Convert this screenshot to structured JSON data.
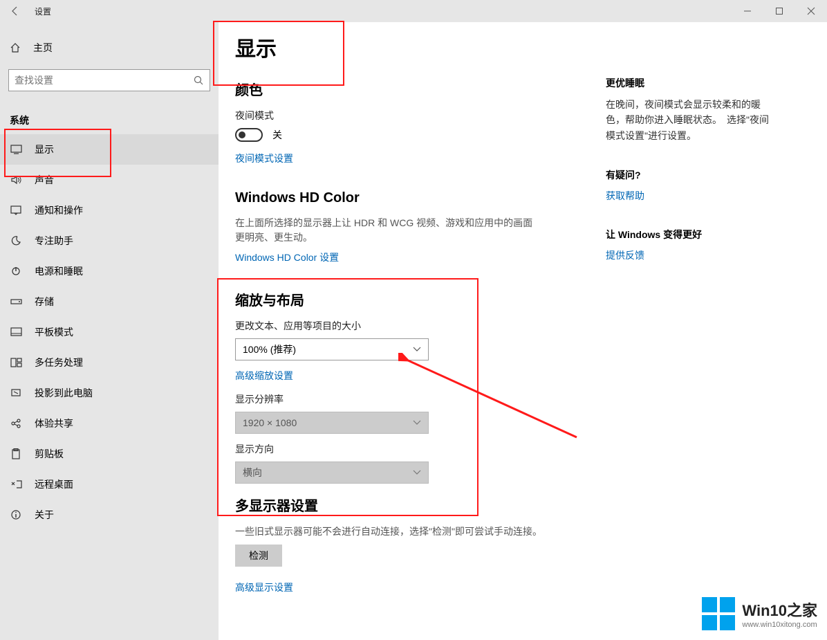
{
  "titlebar": {
    "title": "设置"
  },
  "sidebar": {
    "home": "主页",
    "search_placeholder": "查找设置",
    "section": "系统",
    "items": [
      {
        "label": "显示"
      },
      {
        "label": "声音"
      },
      {
        "label": "通知和操作"
      },
      {
        "label": "专注助手"
      },
      {
        "label": "电源和睡眠"
      },
      {
        "label": "存储"
      },
      {
        "label": "平板模式"
      },
      {
        "label": "多任务处理"
      },
      {
        "label": "投影到此电脑"
      },
      {
        "label": "体验共享"
      },
      {
        "label": "剪贴板"
      },
      {
        "label": "远程桌面"
      },
      {
        "label": "关于"
      }
    ]
  },
  "content": {
    "page_title": "显示",
    "color_hdr": "颜色",
    "night_label": "夜间模式",
    "night_state": "关",
    "night_link": "夜间模式设置",
    "hd_hdr": "Windows HD Color",
    "hd_desc": "在上面所选择的显示器上让 HDR 和 WCG 视频、游戏和应用中的画面更明亮、更生动。",
    "hd_link": "Windows HD Color 设置",
    "scale_hdr": "缩放与布局",
    "scale_label": "更改文本、应用等项目的大小",
    "scale_value": "100% (推荐)",
    "scale_link": "高级缩放设置",
    "res_label": "显示分辨率",
    "res_value": "1920 × 1080",
    "orient_label": "显示方向",
    "orient_value": "横向",
    "multi_hdr": "多显示器设置",
    "multi_desc": "一些旧式显示器可能不会进行自动连接，选择\"检测\"即可尝试手动连接。",
    "detect_btn": "检测",
    "adv_link": "高级显示设置"
  },
  "right": {
    "sleep_hdr": "更优睡眠",
    "sleep_p": "在晚间，夜间模式会显示较柔和的暖色，帮助你进入睡眠状态。　选择\"夜间模式设置\"进行设置。",
    "q_hdr": "有疑问?",
    "q_link": "获取帮助",
    "better_hdr": "让 Windows 变得更好",
    "better_link": "提供反馈"
  },
  "watermark": {
    "line1": "Win10之家",
    "line2": "www.win10xitong.com"
  }
}
